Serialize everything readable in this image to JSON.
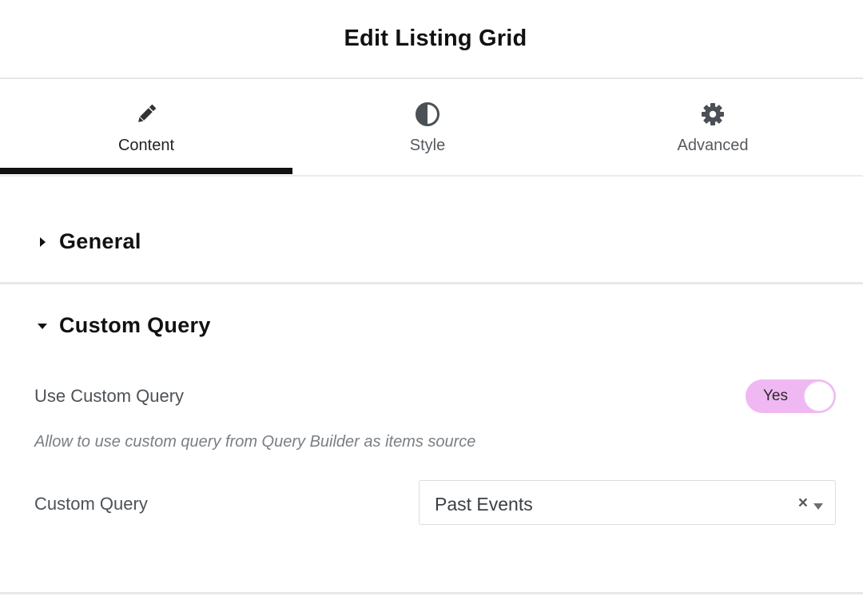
{
  "header": {
    "title": "Edit Listing Grid"
  },
  "tabs": [
    {
      "label": "Content",
      "icon": "pencil-icon",
      "active": true
    },
    {
      "label": "Style",
      "icon": "half-circle-contrast-icon",
      "active": false
    },
    {
      "label": "Advanced",
      "icon": "gear-icon",
      "active": false
    }
  ],
  "sections": {
    "general": {
      "title": "General",
      "expanded": false
    },
    "custom_query": {
      "title": "Custom Query",
      "expanded": true,
      "use_custom_query": {
        "label": "Use Custom Query",
        "toggle_text": "Yes",
        "enabled": true,
        "description": "Allow to use custom query from Query Builder as items source"
      },
      "custom_query_select": {
        "label": "Custom Query",
        "value": "Past Events",
        "clear_symbol": "×"
      }
    }
  },
  "colors": {
    "toggle_on": "#f0b8f2",
    "active_tab_underline": "#111111",
    "divider": "#e8e8e8"
  }
}
